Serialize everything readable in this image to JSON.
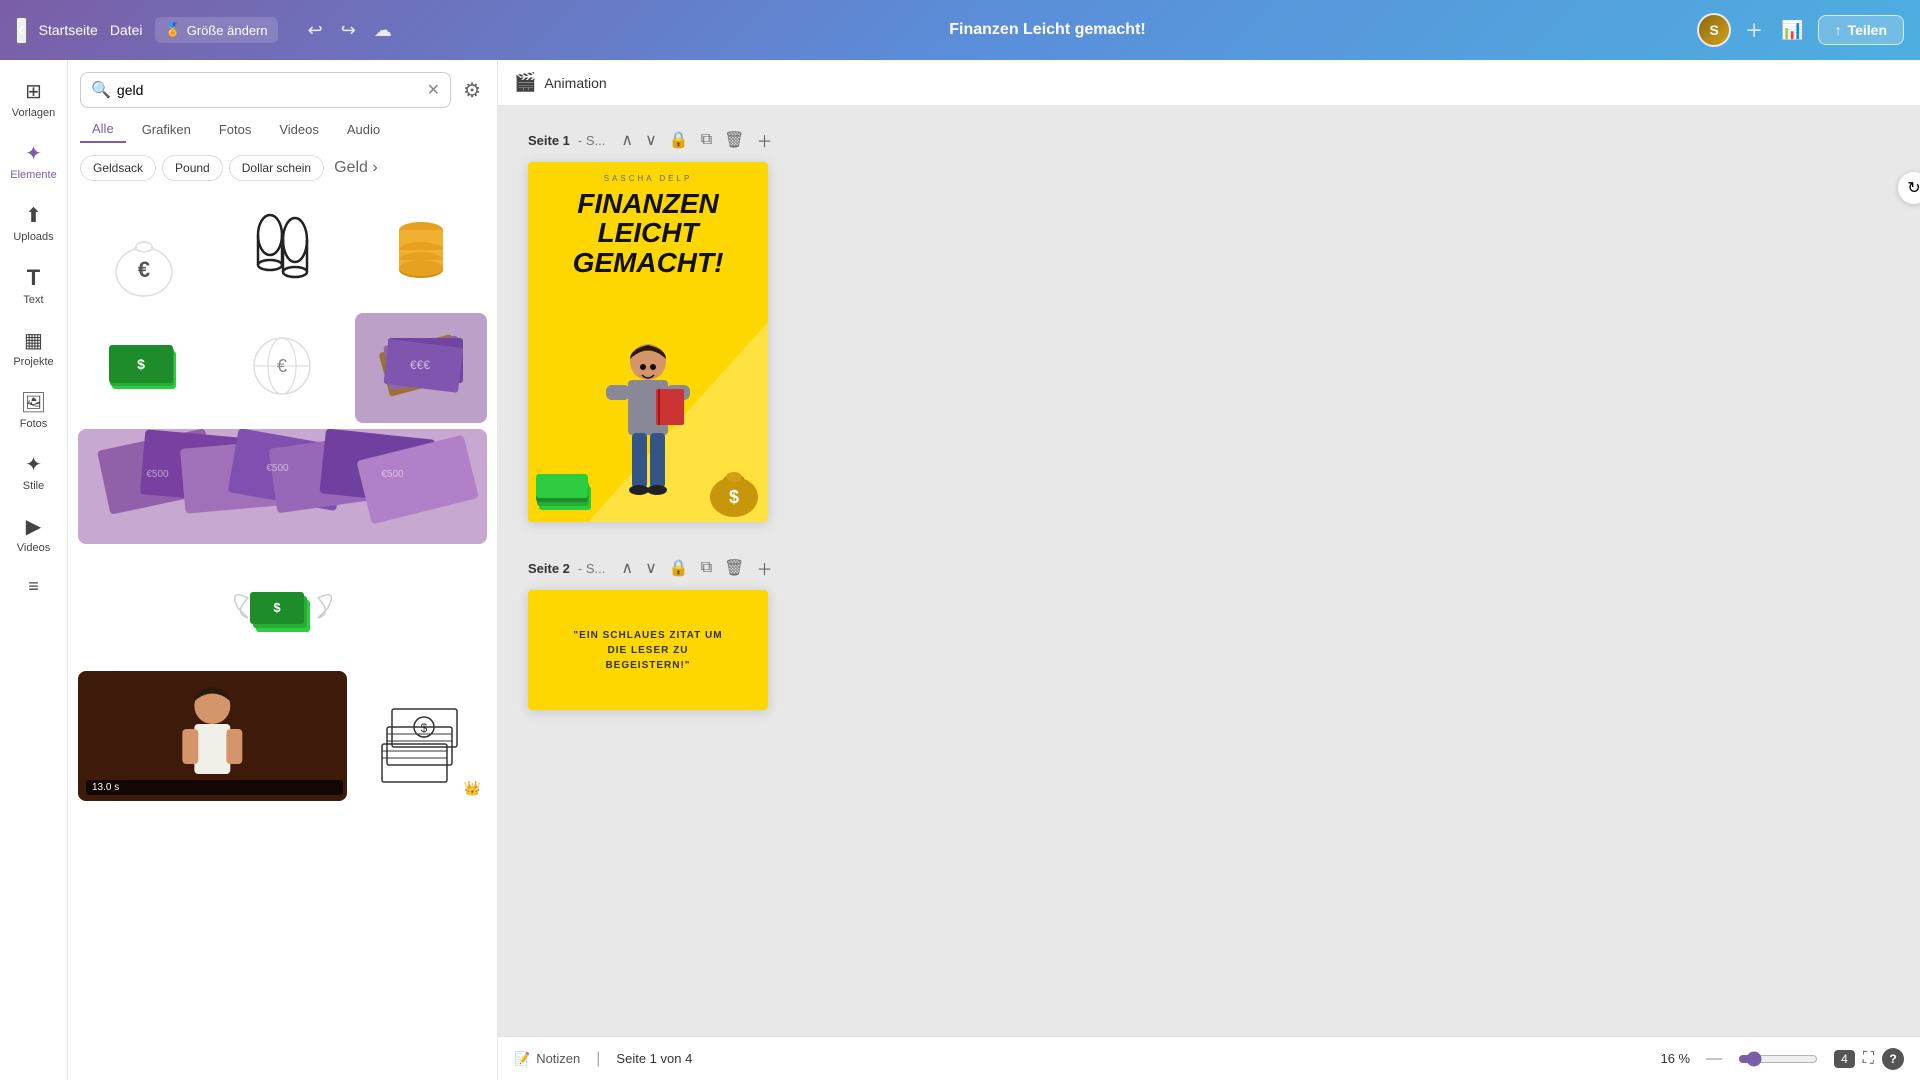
{
  "header": {
    "back_label": "‹",
    "home_label": "Startseite",
    "file_label": "Datei",
    "size_icon": "🎖️",
    "size_label": "Größe ändern",
    "undo_label": "↩",
    "redo_label": "↪",
    "cloud_label": "☁",
    "project_title": "Finanzen Leicht gemacht!",
    "share_icon": "↑",
    "share_label": "Teilen"
  },
  "sidebar": {
    "items": [
      {
        "id": "vorlagen",
        "icon": "⊞",
        "label": "Vorlagen"
      },
      {
        "id": "elemente",
        "icon": "✦",
        "label": "Elemente"
      },
      {
        "id": "uploads",
        "icon": "↑",
        "label": "Uploads"
      },
      {
        "id": "text",
        "icon": "T",
        "label": "Text"
      },
      {
        "id": "projekte",
        "icon": "▦",
        "label": "Projekte"
      },
      {
        "id": "fotos",
        "icon": "🖼",
        "label": "Fotos"
      },
      {
        "id": "stile",
        "icon": "✦",
        "label": "Stile"
      },
      {
        "id": "videos",
        "icon": "▶",
        "label": "Videos"
      },
      {
        "id": "patterns",
        "icon": "≡",
        "label": ""
      }
    ]
  },
  "search": {
    "placeholder": "geld",
    "value": "geld",
    "filter_tabs": [
      {
        "id": "alle",
        "label": "Alle",
        "active": true
      },
      {
        "id": "grafiken",
        "label": "Grafiken",
        "active": false
      },
      {
        "id": "fotos",
        "label": "Fotos",
        "active": false
      },
      {
        "id": "videos",
        "label": "Videos",
        "active": false
      },
      {
        "id": "audio",
        "label": "Audio",
        "active": false
      }
    ],
    "chips": [
      {
        "id": "geldsack",
        "label": "Geldsack"
      },
      {
        "id": "pound",
        "label": "Pound"
      },
      {
        "id": "dollar_schein",
        "label": "Dollar schein"
      },
      {
        "id": "geld_more",
        "label": "Geld›"
      }
    ]
  },
  "results": {
    "items": [
      {
        "id": "euro_bag",
        "type": "graphic",
        "emoji": "💰",
        "bg": "#f8f8f8",
        "description": "White money bag with euro sign"
      },
      {
        "id": "coin_stack",
        "type": "graphic",
        "emoji": "🏦",
        "bg": "#f8f8f8",
        "description": "Black coin stack graphic"
      },
      {
        "id": "gold_coins",
        "type": "graphic",
        "emoji": "🪙",
        "bg": "#f8f8f8",
        "description": "Gold coin stack"
      },
      {
        "id": "green_cash",
        "type": "graphic",
        "emoji": "💵",
        "bg": "#f8f8f8",
        "description": "Green cash stack"
      },
      {
        "id": "euro_coin",
        "type": "graphic",
        "emoji": "🔘",
        "bg": "#f8f8f8",
        "description": "Euro coin graphic"
      },
      {
        "id": "cash_pile",
        "type": "photo",
        "emoji": "💶",
        "bg": "#e8d5c4",
        "description": "Photo of cash pile"
      },
      {
        "id": "euro_notes",
        "type": "photo",
        "emoji": "",
        "bg": "#c8b8d0",
        "description": "Euro banknotes photo",
        "full_width": true
      },
      {
        "id": "winged_cash",
        "type": "graphic",
        "emoji": "💸",
        "bg": "#f8f8f8",
        "description": "Flying money graphic"
      },
      {
        "id": "woman_money",
        "type": "video",
        "emoji": "🎬",
        "bg": "#5a3020",
        "description": "Woman counting money video",
        "badge": "13.0 s",
        "full_width": true
      },
      {
        "id": "cash_sketch",
        "type": "graphic",
        "emoji": "📝",
        "bg": "#f8f8f8",
        "description": "Cash sketch graphic",
        "crown": true
      }
    ]
  },
  "animation_bar": {
    "icon": "🎬",
    "label": "Animation"
  },
  "pages": [
    {
      "id": "page1",
      "label": "Seite 1",
      "subtitle": "- S...",
      "design": {
        "author": "SASCHA DELP",
        "title_line1": "FINANZEN",
        "title_line2": "LEICHT",
        "title_line3": "GEMACHT!"
      }
    },
    {
      "id": "page2",
      "label": "Seite 2",
      "subtitle": "- S...",
      "design": {
        "quote": "\"EIN SCHLAUES ZITAT UM DIE LESER ZU BEGEISTERN!\""
      }
    }
  ],
  "status_bar": {
    "notes_icon": "📝",
    "notes_label": "Notizen",
    "page_info": "Seite 1 von 4",
    "zoom_label": "16 %",
    "zoom_value": 16,
    "page_count_badge": "4",
    "help_icon": "?"
  }
}
